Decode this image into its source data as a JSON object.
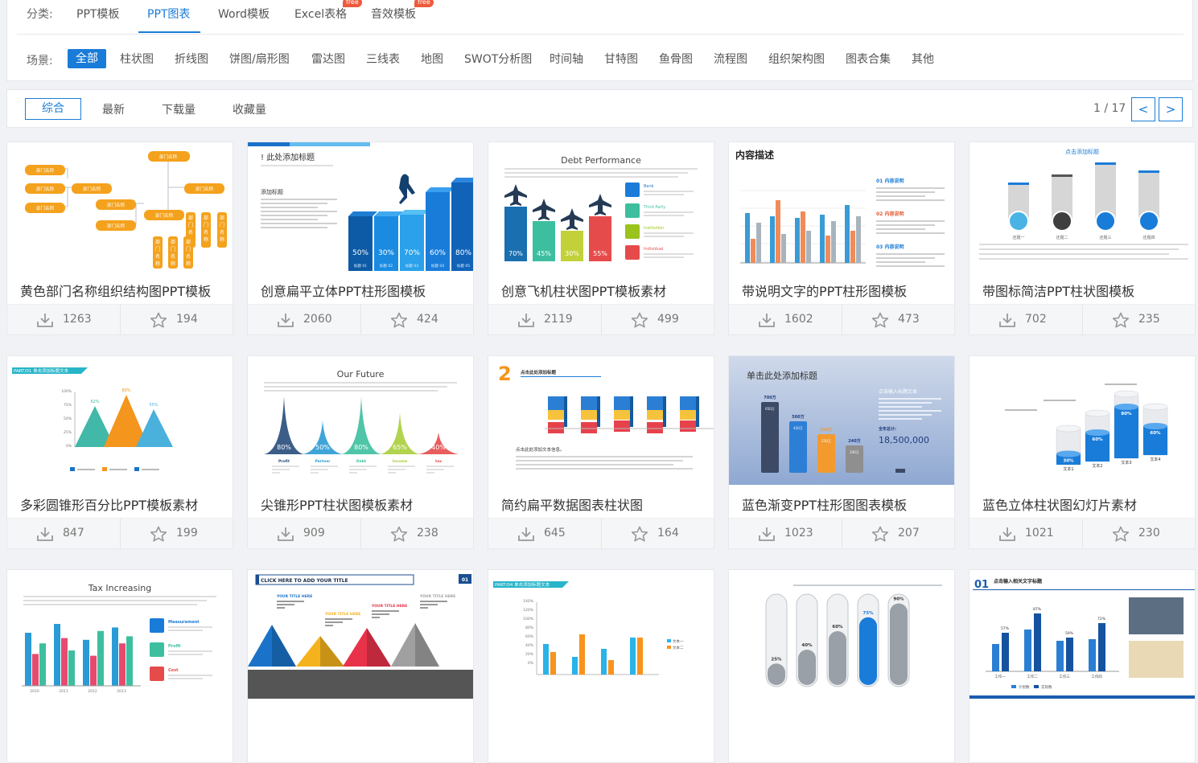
{
  "category": {
    "label": "分类:",
    "tabs": [
      {
        "label": "PPT模板",
        "active": false
      },
      {
        "label": "PPT图表",
        "active": true
      },
      {
        "label": "Word模板",
        "active": false
      },
      {
        "label": "Excel表格",
        "active": false,
        "badge": "free"
      },
      {
        "label": "音效模板",
        "active": false,
        "badge": "free"
      }
    ]
  },
  "scene": {
    "label": "场景:",
    "tabs": [
      "全部",
      "柱状图",
      "折线图",
      "饼图/扇形图",
      "雷达图",
      "三线表",
      "地图",
      "SWOT分析图",
      "时间轴",
      "甘特图",
      "鱼骨图",
      "流程图",
      "组织架构图",
      "图表合集",
      "其他"
    ],
    "active_index": 0
  },
  "sort": {
    "tabs": [
      "综合",
      "最新",
      "下载量",
      "收藏量"
    ],
    "active_index": 0,
    "page": "1 / 17",
    "prev": "<",
    "next": ">"
  },
  "colors": {
    "accent": "#1a7cd9",
    "badge": "#ef5a3c"
  },
  "cards": [
    {
      "title": "黄色部门名称组织结构图PPT模板",
      "downloads": "1263",
      "favorites": "194",
      "thumb": {
        "kind": "org",
        "labels": [
          "部门名称",
          "部门名称",
          "部门名称",
          "部门名称",
          "部门名称",
          "部门名称",
          "部门名称",
          "部门名称",
          "部门名称",
          "部门名称",
          "部门名称"
        ]
      }
    },
    {
      "title": "创意扁平立体PPT柱形图模板",
      "downloads": "2060",
      "favorites": "424",
      "thumb": {
        "kind": "bars3d",
        "heading": "此处添加标题",
        "sub": "添加标题",
        "values": [
          "50%",
          "30%",
          "70%",
          "60%",
          "80%"
        ],
        "tags": [
          "标题 01",
          "标题 02",
          "标题 03",
          "标题 04",
          "标题 05"
        ]
      }
    },
    {
      "title": "创意飞机柱状图PPT模板素材",
      "downloads": "2119",
      "favorites": "499",
      "thumb": {
        "kind": "planes",
        "heading": "Debt Performance",
        "values": [
          "70%",
          "45%",
          "30%",
          "55%"
        ],
        "items": [
          "Bank",
          "Third Party",
          "Institution",
          "Individual"
        ]
      }
    },
    {
      "title": "带说明文字的PPT柱形图模板",
      "downloads": "1602",
      "favorites": "473",
      "thumb": {
        "kind": "groupbars",
        "heading": "内容描述",
        "items": [
          "01 内容说明",
          "02 内容说明",
          "03 内容说明"
        ]
      }
    },
    {
      "title": "带图标简洁PPT柱状图模板",
      "downloads": "702",
      "favorites": "235",
      "thumb": {
        "kind": "iconbars",
        "heading": "点击添加标题",
        "tags": [
          "还题一",
          "还题二",
          "还题三",
          "还题四"
        ]
      }
    },
    {
      "title": "多彩圆锥形百分比PPT模板素材",
      "downloads": "847",
      "favorites": "199",
      "thumb": {
        "kind": "cones",
        "heading": "PART/01",
        "sub": "单击添加标题文本",
        "values": [
          "62%",
          "80%",
          "55%"
        ],
        "axis": [
          "100%",
          "75%",
          "50%",
          "25%",
          "0%"
        ]
      }
    },
    {
      "title": "尖锥形PPT柱状图模板素材",
      "downloads": "909",
      "favorites": "238",
      "thumb": {
        "kind": "spikes",
        "heading": "Our Future",
        "values": [
          "80%",
          "50%",
          "80%",
          "65%",
          "40%"
        ],
        "tags": [
          "Profit",
          "Partner",
          "Debt",
          "Income",
          "tax"
        ]
      }
    },
    {
      "title": "简约扁平数据图表柱状图",
      "downloads": "645",
      "favorites": "164",
      "thumb": {
        "kind": "stacked",
        "heading": "2",
        "sub": "点击此处添加标题",
        "caption": "点击此处添加文本信息。"
      }
    },
    {
      "title": "蓝色渐变PPT柱形图图表模板",
      "downloads": "1023",
      "favorites": "207",
      "thumb": {
        "kind": "bluegrad",
        "heading": "单击此处添加标题",
        "values": [
          "700万",
          "500万",
          "350万",
          "240万"
        ],
        "inner": [
          "650万",
          "420万",
          "230万",
          "240万"
        ],
        "side": "点击输入标题文本",
        "total_label": "全年总计:",
        "total": "18,500,000"
      }
    },
    {
      "title": "蓝色立体柱状图幻灯片素材",
      "downloads": "1021",
      "favorites": "230",
      "thumb": {
        "kind": "cylinders",
        "values": [
          "30%",
          "60%",
          "80%",
          "60%"
        ],
        "tags": [
          "文本1",
          "文本2",
          "文本3",
          "文本4"
        ]
      }
    },
    {
      "title": "",
      "downloads": "",
      "favorites": "",
      "thumb": {
        "kind": "tax",
        "heading": "Tax Increasing",
        "items": [
          "Measurement",
          "Profit",
          "Cost"
        ],
        "years": [
          "2010",
          "2011",
          "2012",
          "2013"
        ]
      }
    },
    {
      "title": "",
      "downloads": "",
      "favorites": "",
      "thumb": {
        "kind": "pyramids",
        "heading": "CLICK HERE TO ADD YOUR TITLE",
        "num": "01",
        "items": [
          "YOUR TITLE HERE",
          "YOUR TITLE HERE",
          "YOUR TITLE HERE",
          "YOUR TITLE HERE"
        ]
      }
    },
    {
      "title": "",
      "downloads": "",
      "favorites": "",
      "thumb": {
        "kind": "linebars",
        "heading": "PART/04",
        "sub": "单击添加标题文本",
        "axis": [
          "140%",
          "120%",
          "100%",
          "80%",
          "60%",
          "40%",
          "20%",
          "0%"
        ],
        "legend": [
          "文本一",
          "文本二"
        ]
      }
    },
    {
      "title": "",
      "downloads": "",
      "favorites": "",
      "thumb": {
        "kind": "tubes",
        "values": [
          "25%",
          "40%",
          "60%",
          "75%",
          "90%"
        ]
      }
    },
    {
      "title": "",
      "downloads": "",
      "favorites": "",
      "thumb": {
        "kind": "photobars",
        "heading": "01",
        "sub": "点击输入相关文字标题",
        "values": [
          "57%",
          "87%",
          "59%",
          "72%"
        ],
        "tags": [
          "工作一",
          "工作二",
          "工作三",
          "工作四"
        ],
        "legend": [
          "计划数",
          "实际数"
        ]
      }
    }
  ]
}
